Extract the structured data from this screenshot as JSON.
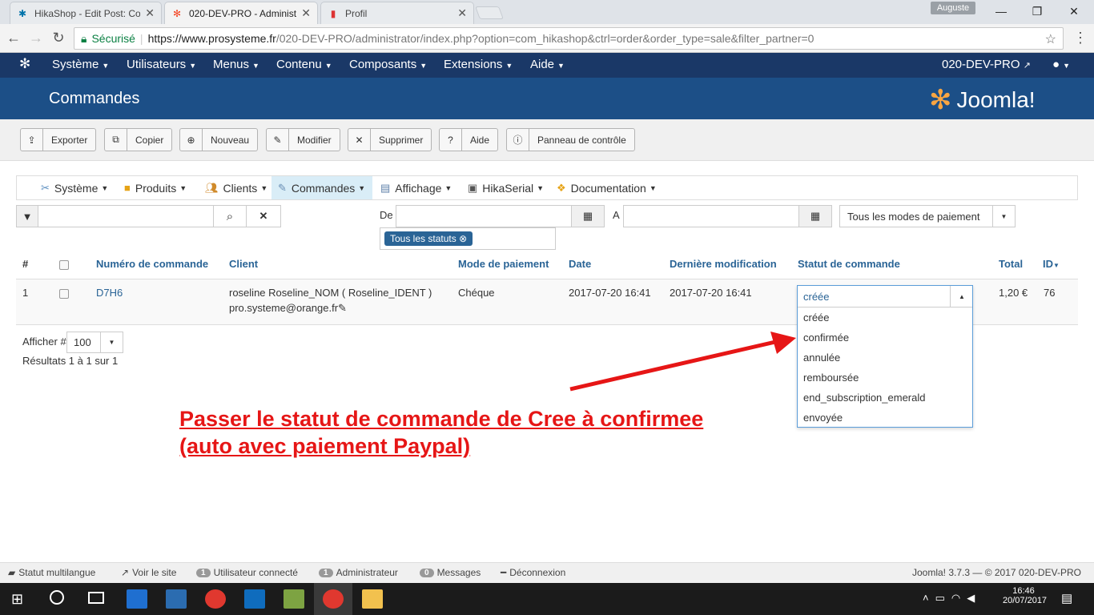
{
  "browser": {
    "tabs": [
      {
        "label": "HikaShop - Edit Post: Cor",
        "icon": "wordpress-icon"
      },
      {
        "label": "020-DEV-PRO - Administ",
        "icon": "joomla-icon",
        "active": true
      },
      {
        "label": "Profil",
        "icon": "profile-icon"
      }
    ],
    "user": "Auguste",
    "secure_label": "Sécurisé",
    "url_host": "https://www.prosysteme.fr",
    "url_path": "/020-DEV-PRO/administrator/index.php?option=com_hikashop&ctrl=order&order_type=sale&filter_partner=0"
  },
  "topnav": {
    "items": [
      "Système",
      "Utilisateurs",
      "Menus",
      "Contenu",
      "Composants",
      "Extensions",
      "Aide"
    ],
    "site": "020-DEV-PRO"
  },
  "header": {
    "title": "Commandes",
    "logo": "Joomla!"
  },
  "toolbar": [
    "Exporter",
    "Copier",
    "Nouveau",
    "Modifier",
    "Supprimer",
    "Aide",
    "Panneau de contrôle"
  ],
  "hikanav": [
    "Système",
    "Produits",
    "Clients",
    "Commandes",
    "Affichage",
    "HikaSerial",
    "Documentation"
  ],
  "filters": {
    "from_label": "De",
    "to_label": "A",
    "payment_select": "Tous les modes de paiement",
    "status_tag": "Tous les statuts"
  },
  "table": {
    "headers": [
      "#",
      "Numéro de commande",
      "Client",
      "Mode de paiement",
      "Date",
      "Dernière modification",
      "Statut de commande",
      "Total",
      "ID"
    ],
    "row": {
      "num": "1",
      "order_number": "D7H6",
      "client_name": "roseline Roseline_NOM ( Roseline_IDENT )",
      "client_email": "pro.systeme@orange.fr",
      "payment": "Chéque",
      "date": "2017-07-20 16:41",
      "modified": "2017-07-20 16:41",
      "status": "créée",
      "total": "1,20 €",
      "id": "76"
    }
  },
  "status_options": [
    "créée",
    "confirmée",
    "annulée",
    "remboursée",
    "end_subscription_emerald",
    "envoyée"
  ],
  "pagination": {
    "show_label": "Afficher #",
    "show_value": "100",
    "results": "Résultats 1 à 1 sur 1"
  },
  "annotation": {
    "line1": "Passer le statut de commande de Cree à confirmee",
    "line2": "(auto avec paiement Paypal)",
    "color": "#e61616"
  },
  "footer": {
    "multilang": "Statut multilangue",
    "view_site": "Voir le site",
    "users_count": "1",
    "users_label": "Utilisateur connecté",
    "admin_count": "1",
    "admin_label": "Administrateur",
    "msg_count": "0",
    "msg_label": "Messages",
    "logout": "Déconnexion",
    "version": "Joomla! 3.7.3 — © 2017 020-DEV-PRO"
  },
  "taskbar": {
    "time": "16:46",
    "date": "20/07/2017"
  }
}
